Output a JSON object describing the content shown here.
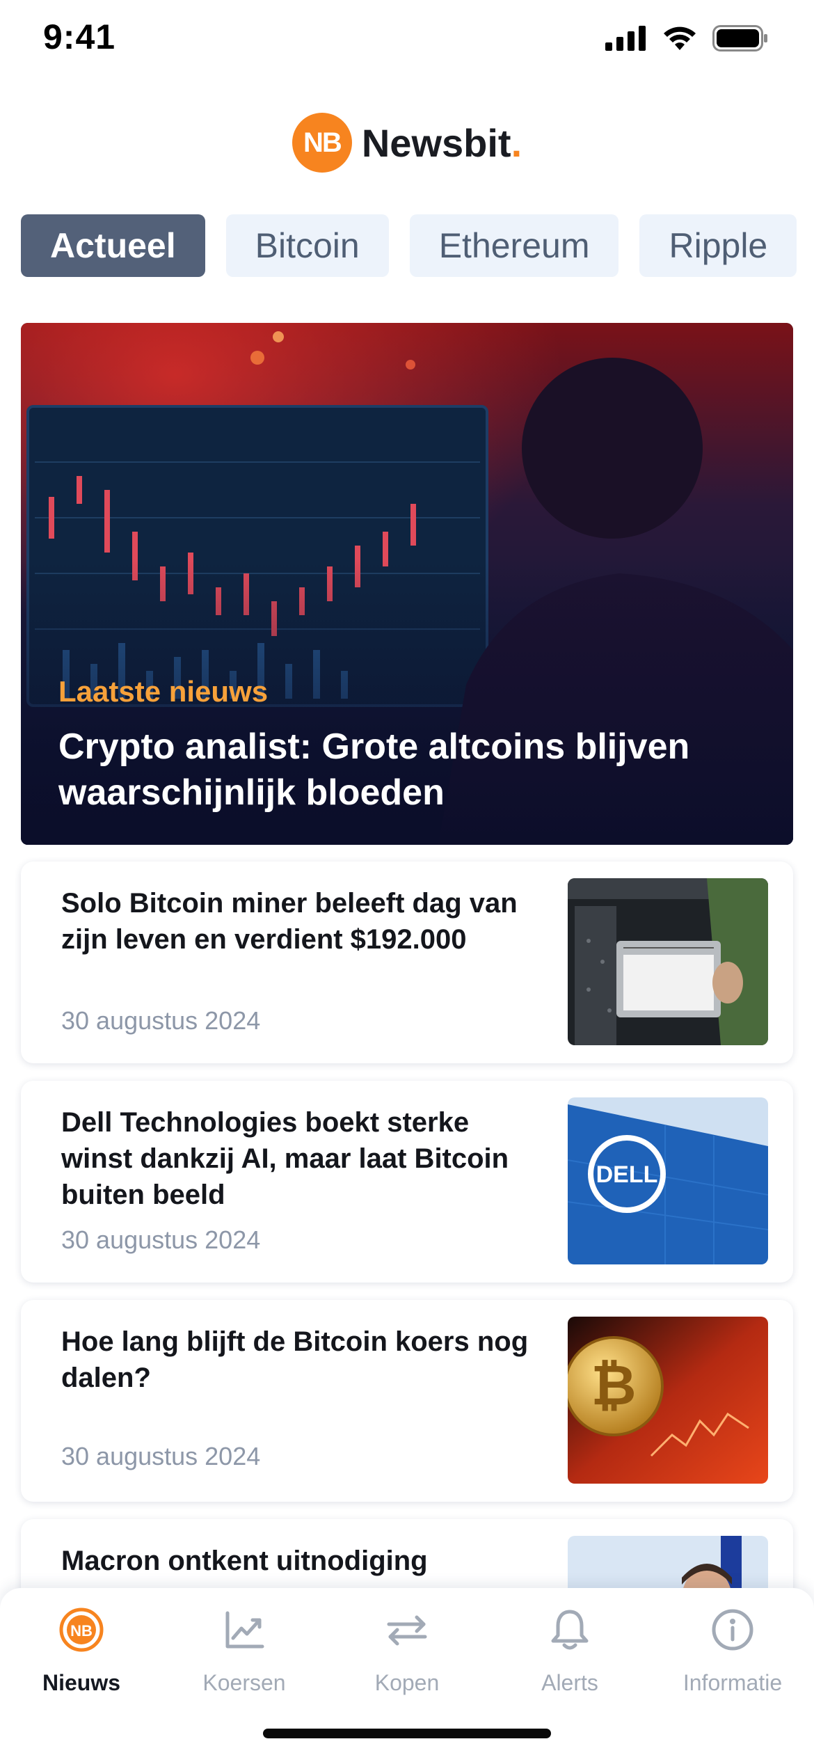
{
  "status_bar": {
    "time": "9:41"
  },
  "brand": {
    "logo_mark": "NB",
    "name": "Newsbit",
    "dot": ".",
    "accent": "#f7841f"
  },
  "tabs": [
    {
      "label": "Actueel",
      "active": true
    },
    {
      "label": "Bitcoin",
      "active": false
    },
    {
      "label": "Ethereum",
      "active": false
    },
    {
      "label": "Ripple",
      "active": false
    }
  ],
  "hero": {
    "kicker": "Laatste nieuws",
    "title": "Crypto analist: Grote altcoins blijven waarschijnlijk bloeden"
  },
  "articles": [
    {
      "title": "Solo Bitcoin miner beleeft dag van zijn leven en verdient $192.000",
      "date": "30 augustus 2024",
      "thumb": "miner-image"
    },
    {
      "title": "Dell Technologies boekt sterke winst dankzij AI, maar laat Bitcoin buiten beeld",
      "date": "30 augustus 2024",
      "thumb": "dell-image"
    },
    {
      "title": "Hoe lang blijft de Bitcoin koers nog dalen?",
      "date": "30 augustus 2024",
      "thumb": "bitcoin-coin-image"
    },
    {
      "title": "Macron ontkent uitnodiging",
      "date": "",
      "thumb": "macron-image"
    }
  ],
  "bottom_nav": [
    {
      "label": "Nieuws",
      "icon": "newsbit-icon",
      "active": true
    },
    {
      "label": "Koersen",
      "icon": "chart-icon",
      "active": false
    },
    {
      "label": "Kopen",
      "icon": "swap-icon",
      "active": false
    },
    {
      "label": "Alerts",
      "icon": "bell-icon",
      "active": false
    },
    {
      "label": "Informatie",
      "icon": "info-icon",
      "active": false
    }
  ],
  "colors": {
    "tab_active_bg": "#536179",
    "tab_bg": "#edf3fb",
    "kicker": "#f7a13a",
    "muted": "#8d97a8"
  }
}
